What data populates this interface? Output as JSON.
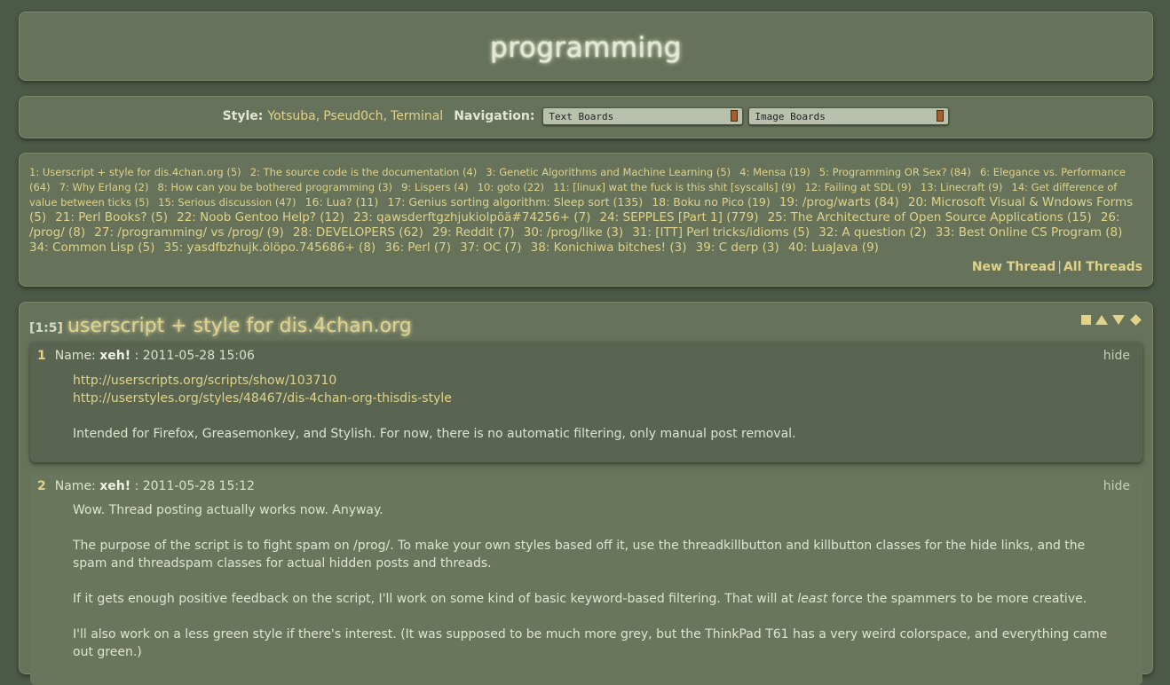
{
  "header": {
    "title": "programming"
  },
  "nav": {
    "style_label": "Style:",
    "styles": [
      "Yotsuba",
      "Pseud0ch",
      "Terminal"
    ],
    "navigation_label": "Navigation:",
    "select_text_boards": "Text Boards",
    "select_image_boards": "Image Boards"
  },
  "thread_list": {
    "items": [
      "1: Userscript + style for dis.4chan.org (5)",
      "2: The source code is the documentation (4)",
      "3: Genetic Algorithms and Machine Learning (5)",
      "4: Mensa (19)",
      "5: Programming OR Sex? (84)",
      "6: Elegance vs. Performance (64)",
      "7: Why Erlang (2)",
      "8: How can you be bothered programming (3)",
      "9: Lispers (4)",
      "10: goto (22)",
      "11: [linux] wat the fuck is this shit [syscalls] (9)",
      "12: Failing at SDL (9)",
      "13: Linecraft (9)",
      "14: Get difference of value between ticks (5)",
      "15: Serious discussion (47)",
      "16: Lua? (11)",
      "17: Genius sorting algorithm: Sleep sort (135)",
      "18: Boku no Pico (19)",
      "19: /prog/warts (84)",
      "20: Microsoft Visual & Wndows Forms (5)",
      "21: Perl Books? (5)",
      "22: Noob Gentoo Help? (12)",
      "23: qawsderftgzhjukiolpöä#74256+ (7)",
      "24: SEPPLES [Part 1] (779)",
      "25: The Architecture of Open Source Applications (15)",
      "26: /prog/ (8)",
      "27: /programming/ vs /prog/ (9)",
      "28: DEVELOPERS (62)",
      "29: Reddit (7)",
      "30: /prog/like (3)",
      "31: [ITT] Perl tricks/idioms (5)",
      "32: A question (2)",
      "33: Best Online CS Program (8)",
      "34: Common Lisp (5)",
      "35: yasdfbzhujk.ölöpo.745686+ (8)",
      "36: Perl (7)",
      "37: OC (7)",
      "38: Konichiwa bitches! (3)",
      "39: C derp (3)",
      "40: LuaJava (9)"
    ],
    "new_thread": "New Thread",
    "separator": "|",
    "all_threads": "All Threads"
  },
  "thread": {
    "number": "[1:5]",
    "title": "userscript + style for dis.4chan.org",
    "posts": [
      {
        "num": "1",
        "name_label": "Name:",
        "name": "xeh!",
        "date": ": 2011-05-28 15:06",
        "hide": "hide",
        "link1": "http://userscripts.org/scripts/show/103710",
        "link2": "http://userstyles.org/styles/48467/dis-4chan-org-thisdis-style",
        "text": "Intended for Firefox, Greasemonkey, and Stylish. For now, there is no automatic filtering, only manual post removal."
      },
      {
        "num": "2",
        "name_label": "Name:",
        "name": "xeh!",
        "date": ": 2011-05-28 15:12",
        "hide": "hide",
        "p1": "Wow. Thread posting actually works now. Anyway.",
        "p2": "The purpose of the script is to fight spam on /prog/. To make your own styles based off it, use the threadkillbutton and killbutton classes for the hide links, and the spam and threadspam classes for actual hidden posts and threads.",
        "p3a": "If it gets enough positive feedback on the script, I'll work on some kind of basic keyword-based filtering. That will at ",
        "p3b": "least",
        "p3c": " force the spammers to be more creative.",
        "p4": "I'll also work on a less green style if there's interest. (It was supposed to be much more grey, but the ThinkPad T61 has a very weird colorspace, and everything came out green.)"
      }
    ]
  }
}
